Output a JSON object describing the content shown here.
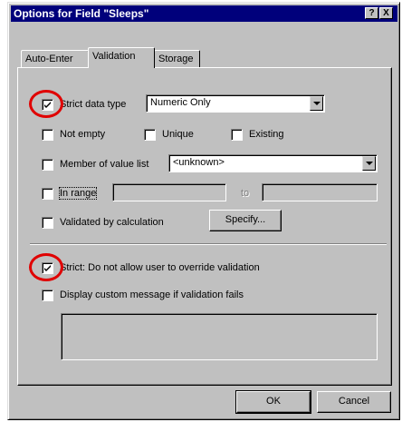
{
  "window": {
    "title": "Options for Field \"Sleeps\"",
    "help_button": "?",
    "close_button": "X"
  },
  "tabs": [
    {
      "label": "Auto-Enter",
      "active": false
    },
    {
      "label": "Validation",
      "active": true
    },
    {
      "label": "Storage",
      "active": false
    }
  ],
  "validation": {
    "strict_data_type": {
      "label": "Strict data type",
      "checked": true,
      "value": "Numeric Only"
    },
    "not_empty": {
      "label": "Not empty",
      "checked": false
    },
    "unique": {
      "label": "Unique",
      "checked": false
    },
    "existing": {
      "label": "Existing",
      "checked": false
    },
    "member_of_value_list": {
      "label": "Member of value list",
      "checked": false,
      "value": "<unknown>"
    },
    "in_range": {
      "label": "In range",
      "checked": false,
      "to_label": "to",
      "from_value": "",
      "to_value": ""
    },
    "validated_by_calculation": {
      "label": "Validated by calculation",
      "checked": false,
      "specify_label": "Specify..."
    },
    "strict_override": {
      "label": "Strict: Do not allow user to override validation",
      "checked": true
    },
    "display_custom_message": {
      "label": "Display custom message if validation fails",
      "checked": false,
      "message": ""
    }
  },
  "footer": {
    "ok_label": "OK",
    "cancel_label": "Cancel"
  },
  "annotations": {
    "highlight_color": "#e00000"
  }
}
